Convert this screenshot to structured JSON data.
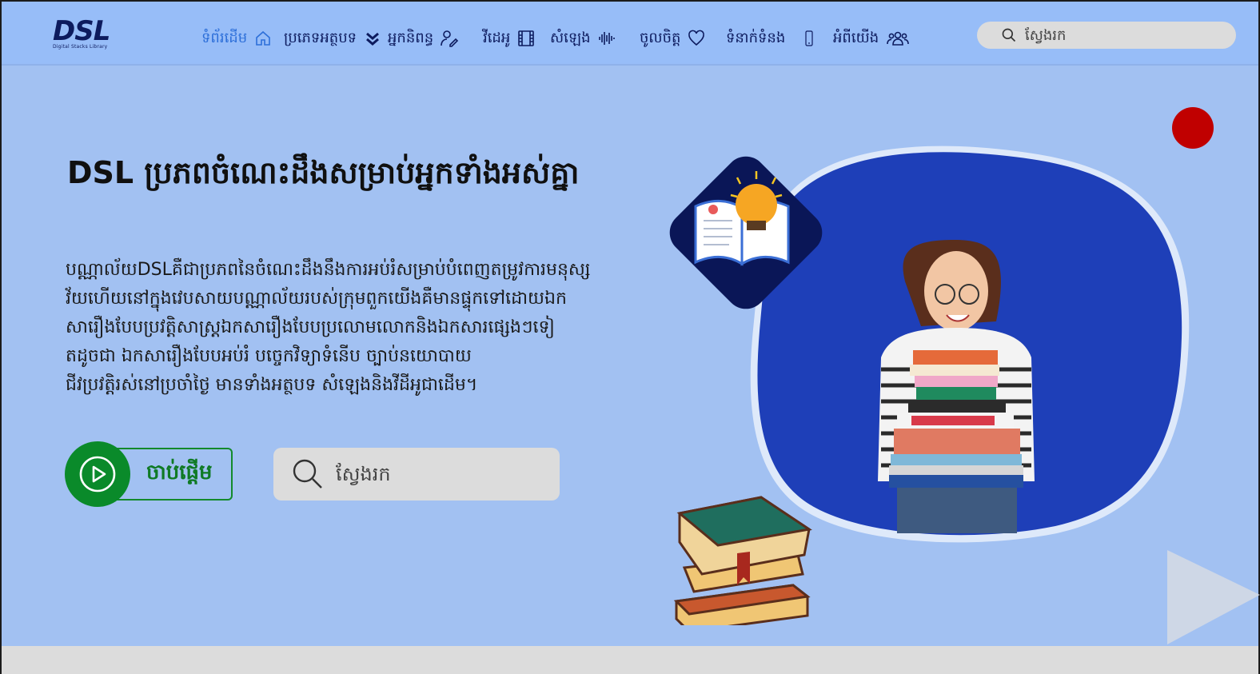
{
  "brand": {
    "logo_text": "DSL",
    "logo_sub": "Digital Stacks Library"
  },
  "nav": {
    "items": [
      {
        "label": "ទំព័រដើម",
        "icon": "home-icon",
        "active": true
      },
      {
        "label": "ប្រភេទអត្ថបទ",
        "icon": "chevron-double-down-icon",
        "active": false
      },
      {
        "label": "អ្នកនិពន្ធ",
        "icon": "pen-user-icon",
        "active": false
      },
      {
        "label": "វីដេអូ",
        "icon": "film-icon",
        "active": false
      },
      {
        "label": "សំឡេង",
        "icon": "audio-wave-icon",
        "active": false
      },
      {
        "label": "ចូលចិត្ត",
        "icon": "heart-icon",
        "active": false
      },
      {
        "label": "ទំនាក់ទំនង",
        "icon": "phone-icon",
        "active": false
      },
      {
        "label": "អំពីយើង",
        "icon": "users-icon",
        "active": false
      }
    ],
    "search_placeholder": "ស្វែងរក"
  },
  "hero": {
    "title": "DSL ប្រភពចំណេះដឹងសម្រាប់អ្នកទាំងអស់គ្នា",
    "description_lines": [
      "បណ្ណាល័យDSLគឺជាប្រភពនៃចំណេះដឹងនឹងការអប់រំសម្រាប់បំពេញតម្រូវការមនុស្ស",
      "វ័យហើយនៅក្នុងវេបសាយបណ្ណាល័យរបស់ក្រុមពួកយើងគឺមានផ្ទុកទៅដោយឯក",
      "សារឿងបែបប្រវត្តិសាស្រ្តឯកសារឿងបែបប្រលោមលោកនិងឯកសារផ្សេងៗទៀ",
      "តដូចជា ឯកសារឿងបែបអប់រំ បច្ចេកវិទ្យាទំនើប ច្បាប់នយោបាយ",
      "ជីវប្រវត្តិរស់នៅប្រចាំថ្ងៃ មានទាំងអត្ថបទ សំឡេងនិងវីដីអូជាដើម។"
    ],
    "start_label": "ចាប់ផ្ដើម",
    "search_placeholder": "ស្វែងរក"
  },
  "colors": {
    "background": "#a2c1f2",
    "navbar": "#97bdf8",
    "accent_blue": "#1e3fb8",
    "navy": "#0a1657",
    "start_green": "#0a8a2a",
    "record_red": "#c00000"
  }
}
